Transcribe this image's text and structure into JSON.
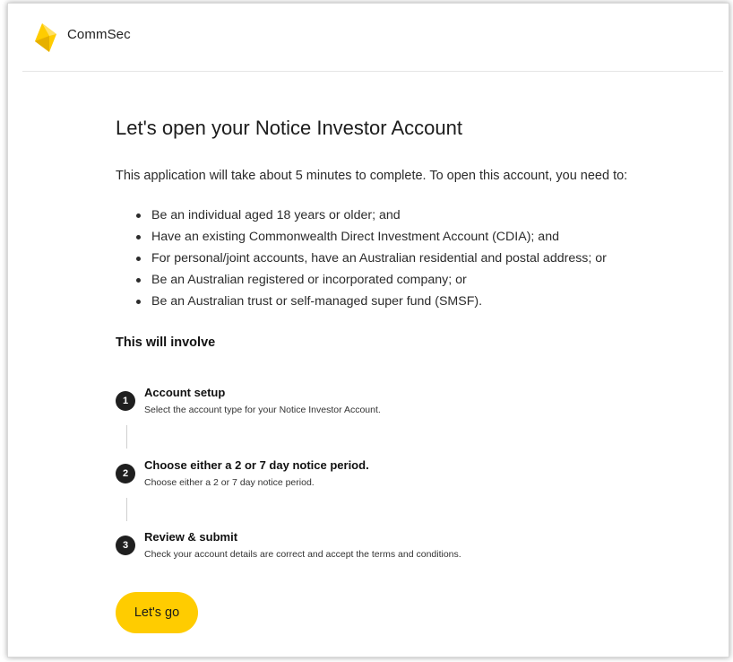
{
  "brand": {
    "name": "CommSec",
    "logo_icon": "commsec-diamond-logo-icon",
    "accent_color": "#ffcc00"
  },
  "page": {
    "title": "Let's open your Notice Investor Account",
    "intro": "This application will take about 5 minutes to complete. To open this account, you need to:",
    "requirements": [
      "Be an individual aged 18 years or older; and",
      "Have an existing Commonwealth Direct Investment Account (CDIA); and",
      "For personal/joint accounts, have an Australian residential and postal address; or",
      "Be an Australian registered or incorporated company; or",
      "Be an Australian trust or self-managed super fund (SMSF)."
    ],
    "involve_heading": "This will involve",
    "steps": [
      {
        "number": "1",
        "title": "Account setup",
        "description": "Select the account type for your Notice Investor Account."
      },
      {
        "number": "2",
        "title": "Choose either a 2 or 7 day notice period.",
        "description": "Choose either a 2 or 7 day notice period."
      },
      {
        "number": "3",
        "title": "Review & submit",
        "description": "Check your account details are correct and accept the terms and conditions."
      }
    ],
    "cta_label": "Let's go"
  }
}
